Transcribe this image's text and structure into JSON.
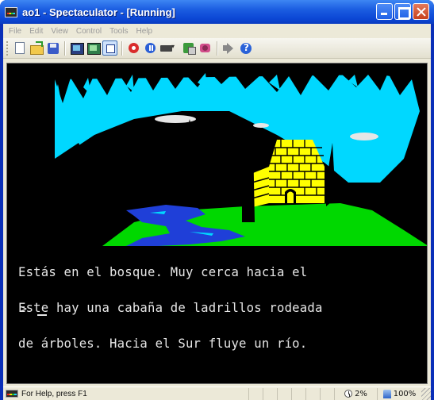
{
  "window": {
    "title": "ao1 - Spectaculator - [Running]"
  },
  "menu": {
    "items": [
      "File",
      "Edit",
      "View",
      "Control",
      "Tools",
      "Help"
    ]
  },
  "toolbar": {
    "icons": [
      "new-file-icon",
      "open-folder-icon",
      "save-disk-icon",
      "monitor-icon",
      "screen-icon",
      "window-icon",
      "record-icon",
      "pause-icon",
      "keyboard-icon",
      "tape-icon",
      "joystick-icon",
      "sound-icon",
      "help-icon"
    ]
  },
  "game": {
    "description_lines": [
      "Estás en el bosque. Muy cerca hacia el",
      "Este hay una cabaña de ladrillos rodeada",
      "de árboles. Hacia el Sur fluye un río."
    ],
    "prompt": ">",
    "colors": {
      "sky": "#00d8ff",
      "forest": "#000000",
      "grass": "#00d800",
      "water": "#1f3fd8",
      "cabin": "#ffff00"
    }
  },
  "status": {
    "help_text": "For Help, press F1",
    "cpu": "2%",
    "speed": "100%"
  }
}
